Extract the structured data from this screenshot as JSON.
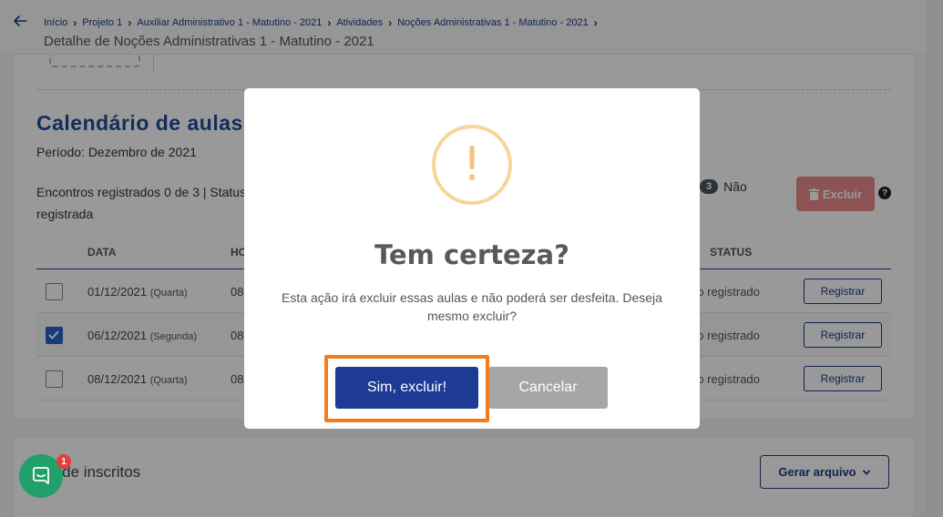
{
  "header": {
    "breadcrumb": [
      "Início",
      "Projeto 1",
      "Auxiliar Administrativo 1 - Matutino - 2021",
      "Atividades",
      "Noções Administrativas 1 - Matutino - 2021"
    ],
    "title": "Detalhe de Noções Administrativas 1 - Matutino - 2021"
  },
  "calendar": {
    "title": "Calendário de aulas",
    "periodo": "Período: Dezembro de 2021",
    "encontros": "Encontros registrados 0 de 3 | Status registrada",
    "legend_count": "3",
    "legend_label": "Não",
    "excluir_label": "Excluir",
    "help": "?",
    "columns": {
      "data": "DATA",
      "hora": "HO",
      "status": "STATUS"
    },
    "rows": [
      {
        "date": "01/12/2021",
        "weekday": "(Quarta)",
        "hora": "08",
        "status": "ão registrado",
        "action": "Registrar",
        "checked": false
      },
      {
        "date": "06/12/2021",
        "weekday": "(Segunda)",
        "hora": "08",
        "status": "ão registrado",
        "action": "Registrar",
        "checked": true
      },
      {
        "date": "08/12/2021",
        "weekday": "(Quarta)",
        "hora": "08",
        "status": "ão registrado",
        "action": "Registrar",
        "checked": false
      }
    ]
  },
  "inscritos": {
    "title": "a de inscritos",
    "gerar_label": "Gerar arquivo"
  },
  "chat": {
    "badge": "1"
  },
  "modal": {
    "icon": "!",
    "title": "Tem certeza?",
    "text": "Esta ação irá excluir essas aulas e não poderá ser desfeita. Deseja mesmo excluir?",
    "confirm_label": "Sim, excluir!",
    "cancel_label": "Cancelar"
  }
}
